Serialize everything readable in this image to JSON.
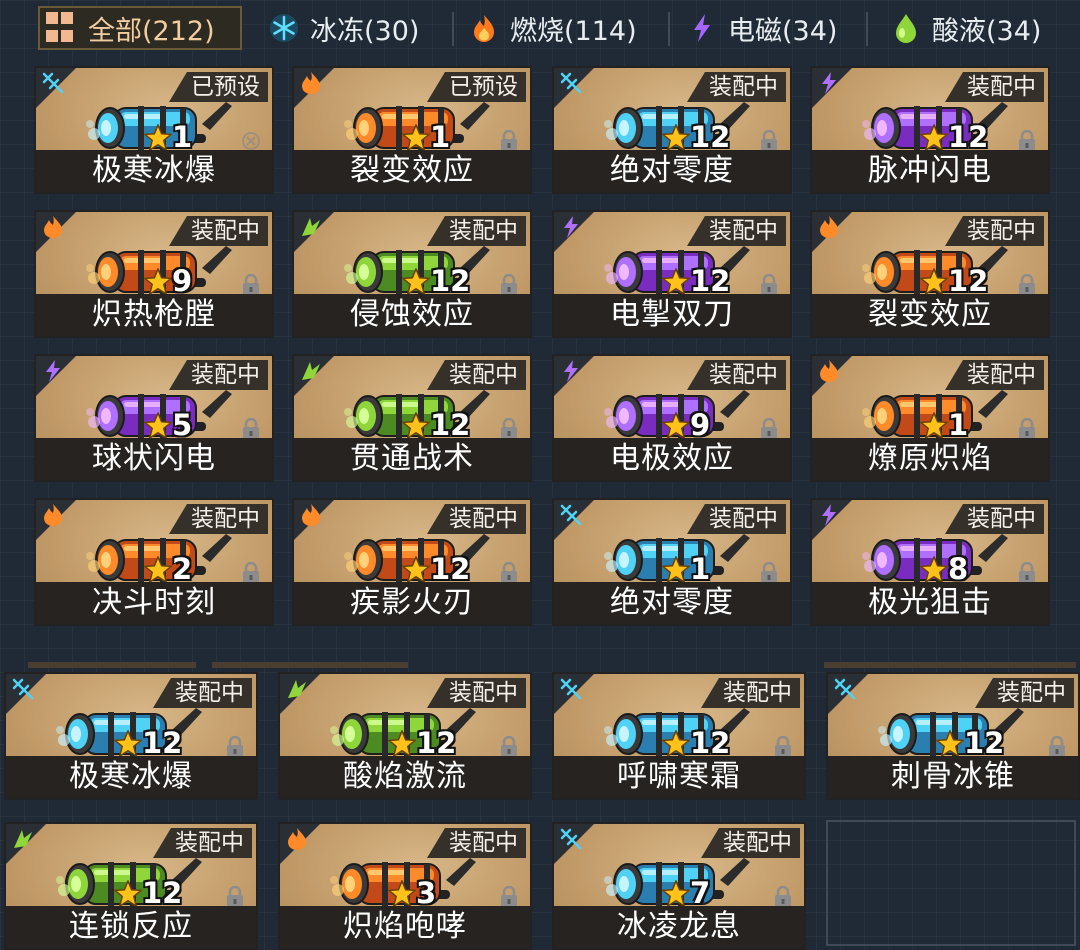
{
  "filters": [
    {
      "label": "全部(212)",
      "icon": "grid-icon",
      "active": true
    },
    {
      "label": "冰冻(30)",
      "icon": "snowflake-icon",
      "active": false
    },
    {
      "label": "燃烧(114)",
      "icon": "flame-icon",
      "active": false
    },
    {
      "label": "电磁(34)",
      "icon": "lightning-icon",
      "active": false
    },
    {
      "label": "酸液(34)",
      "icon": "acid-drop-icon",
      "active": false
    }
  ],
  "colors": {
    "ice": "#4fd2f5",
    "fire": "#ff8a2a",
    "electric": "#b070ff",
    "acid": "#8fd63a",
    "card_bg": "#c9a371",
    "name_bar": "#262320",
    "tab_active_text": "#f2cda0"
  },
  "weapons": [
    {
      "name": "极寒冰爆",
      "status": "已预设",
      "level": "1",
      "element": "ice",
      "locked": false
    },
    {
      "name": "裂变效应",
      "status": "已预设",
      "level": "1",
      "element": "fire",
      "locked": true
    },
    {
      "name": "绝对零度",
      "status": "装配中",
      "level": "12",
      "element": "ice",
      "locked": true
    },
    {
      "name": "脉冲闪电",
      "status": "装配中",
      "level": "12",
      "element": "electric",
      "locked": true
    },
    {
      "name": "炽热枪膛",
      "status": "装配中",
      "level": "9",
      "element": "fire",
      "locked": true
    },
    {
      "name": "侵蚀效应",
      "status": "装配中",
      "level": "12",
      "element": "acid",
      "locked": true
    },
    {
      "name": "电掣双刀",
      "status": "装配中",
      "level": "12",
      "element": "electric",
      "locked": true
    },
    {
      "name": "裂变效应",
      "status": "装配中",
      "level": "12",
      "element": "fire",
      "locked": true
    },
    {
      "name": "球状闪电",
      "status": "装配中",
      "level": "5",
      "element": "electric",
      "locked": true
    },
    {
      "name": "贯通战术",
      "status": "装配中",
      "level": "12",
      "element": "acid",
      "locked": true
    },
    {
      "name": "电极效应",
      "status": "装配中",
      "level": "9",
      "element": "electric",
      "locked": true
    },
    {
      "name": "燎原炽焰",
      "status": "装配中",
      "level": "1",
      "element": "fire",
      "locked": true
    },
    {
      "name": "决斗时刻",
      "status": "装配中",
      "level": "2",
      "element": "fire",
      "locked": true
    },
    {
      "name": "疾影火刃",
      "status": "装配中",
      "level": "12",
      "element": "fire",
      "locked": true
    },
    {
      "name": "绝对零度",
      "status": "装配中",
      "level": "1",
      "element": "ice",
      "locked": true
    },
    {
      "name": "极光狙击",
      "status": "装配中",
      "level": "8",
      "element": "electric",
      "locked": true
    },
    {
      "name": "极寒冰爆",
      "status": "装配中",
      "level": "12",
      "element": "ice",
      "locked": true
    },
    {
      "name": "酸焰激流",
      "status": "装配中",
      "level": "12",
      "element": "acid",
      "locked": true
    },
    {
      "name": "呼啸寒霜",
      "status": "装配中",
      "level": "12",
      "element": "ice",
      "locked": true
    },
    {
      "name": "刺骨冰锥",
      "status": "装配中",
      "level": "12",
      "element": "ice",
      "locked": true
    },
    {
      "name": "连锁反应",
      "status": "装配中",
      "level": "12",
      "element": "acid",
      "locked": true
    },
    {
      "name": "炽焰咆哮",
      "status": "装配中",
      "level": "3",
      "element": "fire",
      "locked": true
    },
    {
      "name": "冰凌龙息",
      "status": "装配中",
      "level": "7",
      "element": "ice",
      "locked": true
    }
  ]
}
